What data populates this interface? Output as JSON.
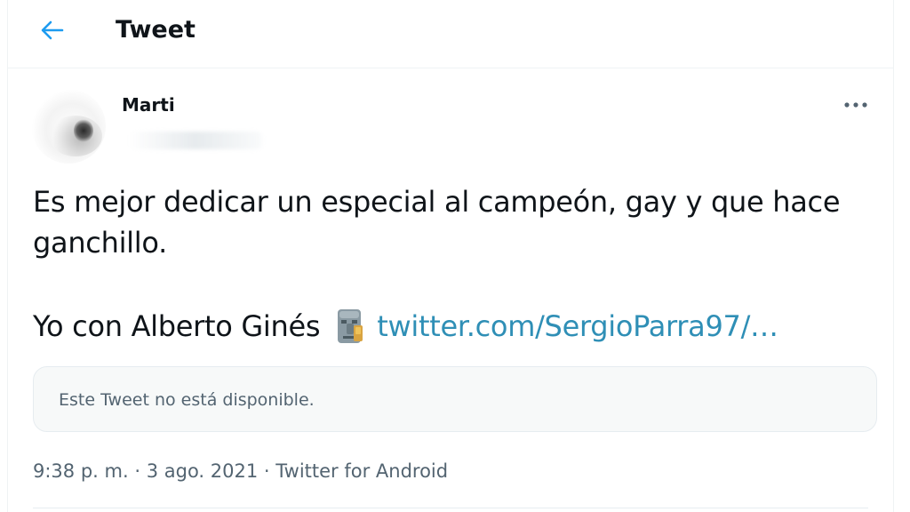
{
  "header": {
    "title": "Tweet",
    "back_icon": "arrow-left-icon",
    "accent_color": "#1d9bf0"
  },
  "tweet": {
    "author": {
      "display_name": "Marti",
      "avatar_icon": "avatar"
    },
    "more_icon": "more-horizontal-icon",
    "text_line1": "Es mejor dedicar un especial al campeón, gay y que hace ganchillo.",
    "text_line2_prefix": "Yo con Alberto Ginés",
    "emoji_icon": "moai-icon",
    "link_text": "twitter.com/SergioParra97/…",
    "link_color": "#2f8fb6",
    "quoted": {
      "unavailable_text": "Este Tweet no está disponible."
    },
    "meta": {
      "time": "9:38 p. m.",
      "date": "3 ago. 2021",
      "source": "Twitter for Android",
      "separator": "·"
    }
  }
}
